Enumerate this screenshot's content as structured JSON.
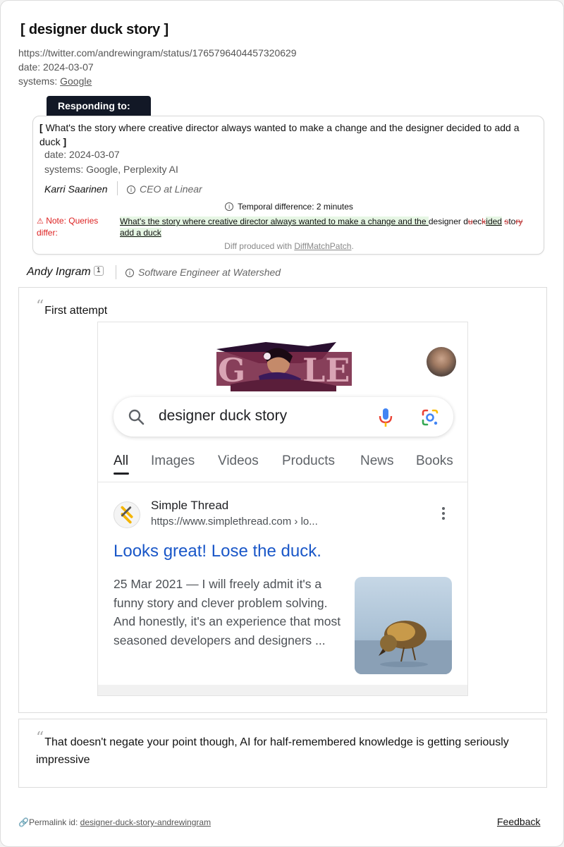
{
  "page": {
    "title": "designer duck story",
    "url": "https://twitter.com/andrewingram/status/1765796404457320629",
    "date_label": "date: 2024-03-07",
    "systems_prefix": "systems: ",
    "systems_link": "Google"
  },
  "responding": {
    "tab_label": "Responding to:",
    "question": "What's the story where creative director always wanted to make a change and the designer decided to add a duck",
    "date_label": "date: 2024-03-07",
    "systems_label": "systems: Google, Perplexity AI",
    "person_name": "Karri Saarinen",
    "person_role": "CEO at Linear",
    "temporal": "Temporal difference: 2 minutes",
    "note": "Note: Queries differ:",
    "diff": {
      "eq1": "What's the story where creative director always wanted to make a change and the ",
      "plain1": "designer d",
      "del1": "u",
      "plain2": "ec",
      "del2": "k",
      "ins1": "ided",
      "del3": "s",
      "plain3": "to",
      "del4": "ry",
      "ins2": " add a duck"
    },
    "diff_by_prefix": "Diff produced with ",
    "diff_by_link": "DiffMatchPatch",
    "diff_by_suffix": "."
  },
  "author": {
    "name": "Andy Ingram",
    "badge": "1",
    "role": "Software Engineer at Watershed"
  },
  "quote1": {
    "text": "First attempt",
    "screenshot": {
      "search_query": "designer duck story",
      "tabs": [
        "All",
        "Images",
        "Videos",
        "Products",
        "News",
        "Books"
      ],
      "site_name": "Simple Thread",
      "site_url": "https://www.simplethread.com › lo...",
      "result_title": "Looks great! Lose the duck.",
      "snippet": "25 Mar 2021 — I will freely admit it's a funny story and clever problem solving. And honestly, it's an experience that most seasoned developers and designers ..."
    }
  },
  "quote2": {
    "text": "That doesn't negate your point though, AI for half-remembered knowledge is getting seriously impressive"
  },
  "footer": {
    "permalink_prefix": "Permalink id: ",
    "permalink_id": "designer-duck-story-andrewingram",
    "feedback": "Feedback"
  },
  "colors": {
    "tab_bg": "#121826",
    "note_red": "#dd2222",
    "diff_green": "#e6f6e4",
    "google_link_blue": "#1a57c8"
  },
  "icons": [
    "info-icon",
    "warning-icon",
    "search-icon",
    "mic-icon",
    "lens-icon",
    "link-icon",
    "kebab-icon"
  ]
}
